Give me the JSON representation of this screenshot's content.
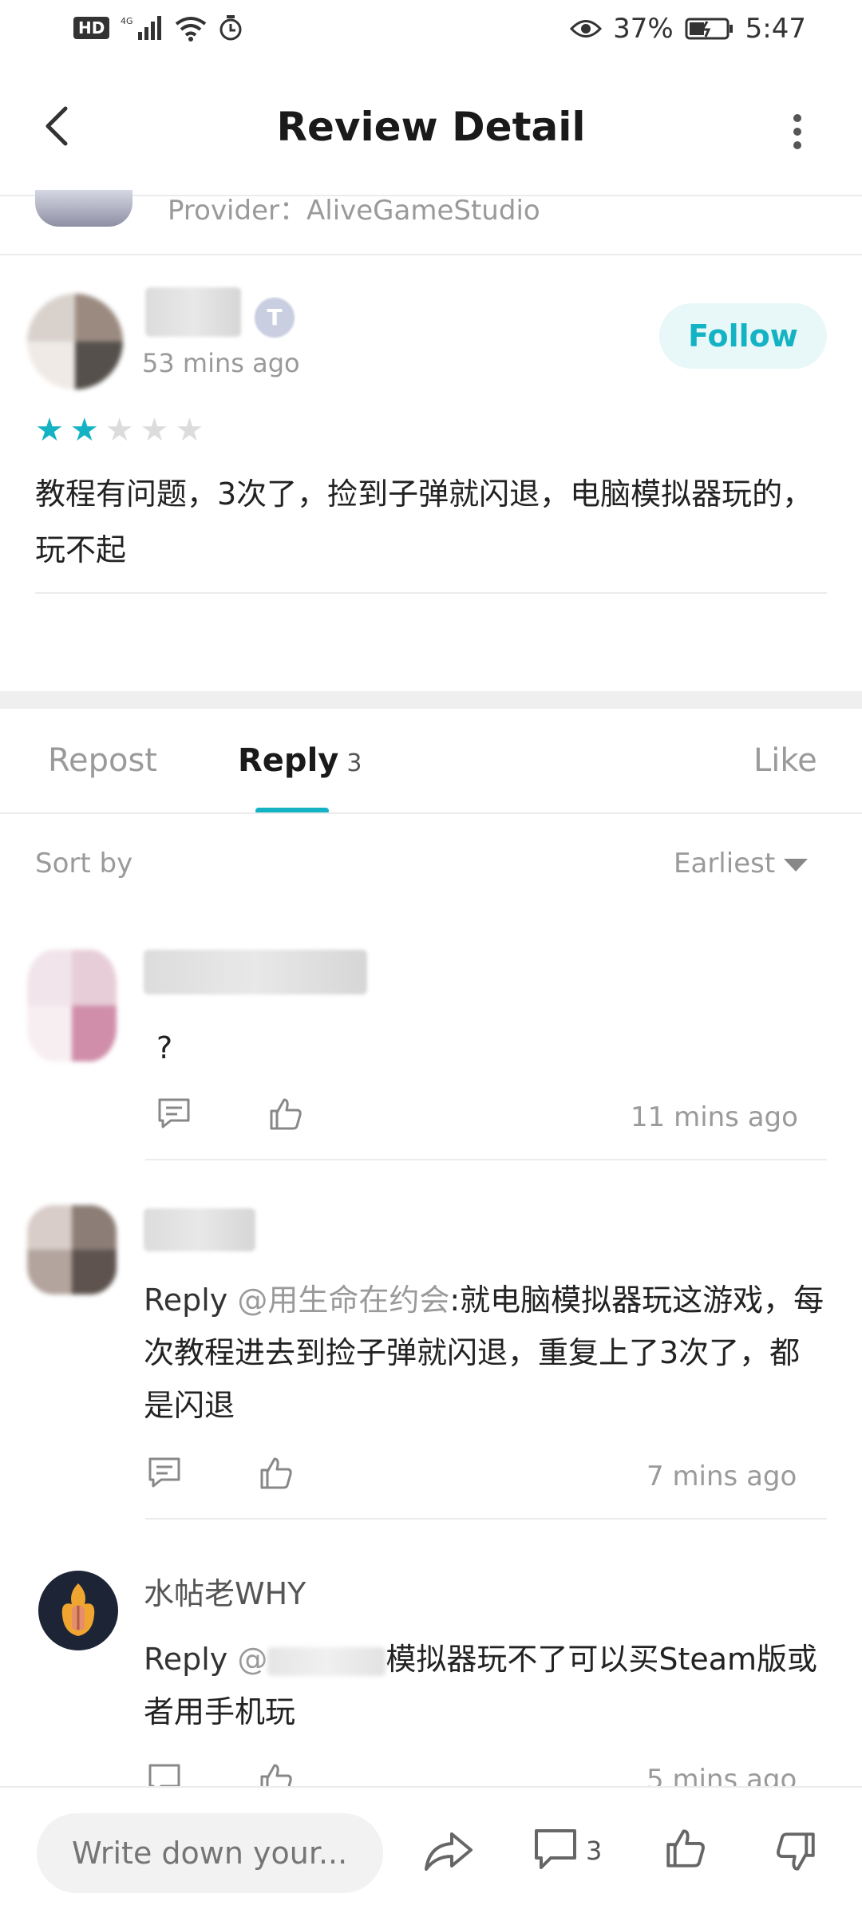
{
  "status_bar": {
    "left_indicators": "HD 4G",
    "battery_percent": "37%",
    "time": "5:47"
  },
  "header": {
    "title": "Review Detail"
  },
  "game": {
    "provider": "Provider：AliveGameStudio"
  },
  "review": {
    "author_badge": "T",
    "time_ago": "53 mins ago",
    "follow_label": "Follow",
    "rating": 2,
    "rating_max": 5,
    "text": "教程有问题，3次了，捡到子弹就闪退，电脑模拟器玩的，玩不起"
  },
  "tabs": {
    "repost": "Repost",
    "reply": "Reply",
    "reply_count": "3",
    "like": "Like"
  },
  "sort": {
    "label": "Sort by",
    "value": "Earliest"
  },
  "comments": [
    {
      "text": "?",
      "time_ago": "11 mins ago"
    },
    {
      "reply_word": "Reply ",
      "mention": "@用生命在约会",
      "text": ":就电脑模拟器玩这游戏，每次教程进去到捡子弹就闪退，重复上了3次了，都是闪退",
      "time_ago": "7 mins ago"
    },
    {
      "author": "水帖老WHY",
      "reply_word": "Reply ",
      "mention": "@",
      "text": "模拟器玩不了可以买Steam版或者用手机玩",
      "time_ago": "5 mins ago"
    }
  ],
  "bottom_bar": {
    "input_placeholder": "Write down your...",
    "comment_count": "3"
  },
  "colors": {
    "accent": "#14b3c4",
    "follow_bg": "#e8f7f8",
    "muted_text": "#9a9a9a"
  }
}
